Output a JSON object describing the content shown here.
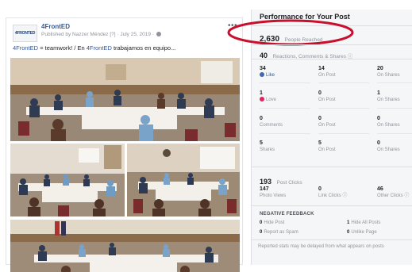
{
  "post": {
    "avatar_text": "4FRONTED",
    "page_name": "4FrontED",
    "byline": "Published by Nazzer Méndez [?] · July 25, 2019 ·",
    "more": "•••",
    "caption_tag1": "4FrontED",
    "caption_mid": " = teamwork! / En ",
    "caption_tag2": "4FrontED",
    "caption_end": " trabajamos en equipo..."
  },
  "panel": {
    "title": "Performance for Your Post",
    "reach": {
      "value": "2,630",
      "label": "People Reached"
    },
    "reactions": {
      "value": "40",
      "label": "Reactions, Comments & Shares ⓘ"
    },
    "stats": [
      {
        "value": "34",
        "label": "Like"
      },
      {
        "value": "14",
        "label": "On Post"
      },
      {
        "value": "20",
        "label": "On Shares"
      },
      {
        "value": "1",
        "label": "Love"
      },
      {
        "value": "0",
        "label": "On Post"
      },
      {
        "value": "1",
        "label": "On Shares"
      },
      {
        "value": "0",
        "label": "Comments"
      },
      {
        "value": "0",
        "label": "On Post"
      },
      {
        "value": "0",
        "label": "On Shares"
      },
      {
        "value": "5",
        "label": "Shares"
      },
      {
        "value": "5",
        "label": "On Post"
      },
      {
        "value": "0",
        "label": "On Shares"
      }
    ],
    "clicks": {
      "value": "193",
      "label": "Post Clicks"
    },
    "click_stats": [
      {
        "value": "147",
        "label": "Photo Views"
      },
      {
        "value": "0",
        "label": "Link Clicks ⓘ"
      },
      {
        "value": "46",
        "label": "Other Clicks ⓘ"
      }
    ],
    "negative": {
      "title": "NEGATIVE FEEDBACK",
      "items": [
        {
          "value": "0",
          "label": "Hide Post"
        },
        {
          "value": "1",
          "label": "Hide All Posts"
        },
        {
          "value": "0",
          "label": "Report as Spam"
        },
        {
          "value": "0",
          "label": "Unlike Page"
        }
      ]
    },
    "footnote": "Reported stats may be delayed from what appears on posts"
  },
  "colors": {
    "link": "#365899",
    "highlight_ring": "#c8102e",
    "like": "#4267b2",
    "love": "#e0245e"
  },
  "icons": [
    "globe-icon",
    "more-icon",
    "like-icon",
    "love-icon",
    "info-icon"
  ]
}
